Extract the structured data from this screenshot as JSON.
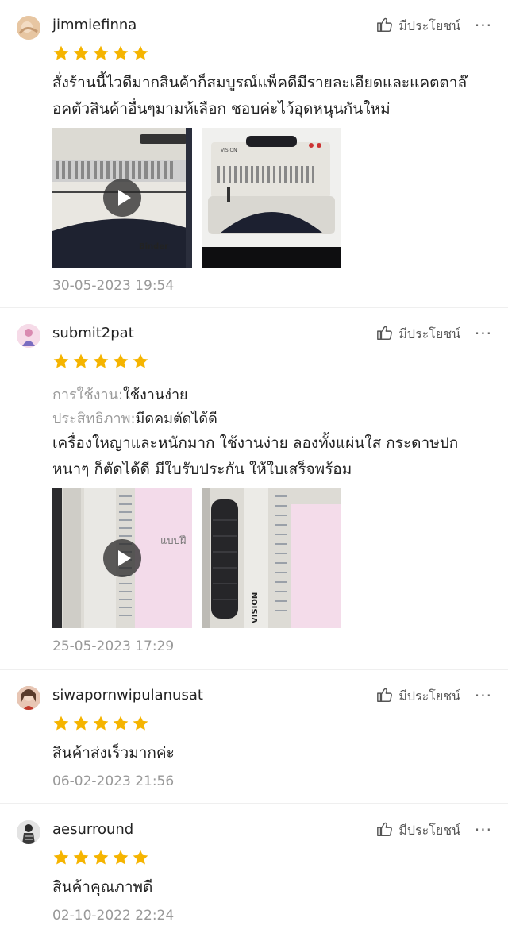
{
  "helpful_label": "มีประโยชน์",
  "more_label": "···",
  "star_color": "#f5b400",
  "reviews": [
    {
      "username": "jimmiefinna",
      "rating": 5,
      "text_lines": [
        "สั่งร้านนี้ไวดีมากสินค้าก็สมบูรณ์แพ็คดีมีรายละเอียดและแคตตาล๊",
        "อคตัวสินค้าอื่นๆมามห้เลือก  ชอบค่ะไว้อุดหนุนกันใหม่"
      ],
      "media": [
        {
          "type": "video",
          "caption": "Binder"
        },
        {
          "type": "image",
          "caption": "VISION"
        }
      ],
      "date": "30-05-2023 19:54"
    },
    {
      "username": "submit2pat",
      "rating": 5,
      "attributes": [
        {
          "key": "การใช้งาน:",
          "value": "ใช้งานง่าย"
        },
        {
          "key": "ประสิทธิภาพ:",
          "value": "มีดคมตัดได้ดี"
        }
      ],
      "text_lines": [
        "เครื่องใหญาและหนักมาก ใช้งานง่าย ลองทั้งแผ่นใส กระดาษปก",
        "หนาๆ ก็ตัดได้ดี  มีใบรับประกัน ให้ใบเสร็จพร้อม"
      ],
      "media": [
        {
          "type": "video",
          "caption": "แบบฝึ"
        },
        {
          "type": "image",
          "caption": "VISION"
        }
      ],
      "date": "25-05-2023 17:29"
    },
    {
      "username": "siwapornwipulanusat",
      "rating": 5,
      "text_lines": [
        "สินค้าส่งเร็วมากค่ะ"
      ],
      "date": "06-02-2023 21:56"
    },
    {
      "username": "aesurround",
      "rating": 5,
      "text_lines": [
        "สินค้าคุณภาพดี"
      ],
      "date": "02-10-2022 22:24"
    }
  ]
}
